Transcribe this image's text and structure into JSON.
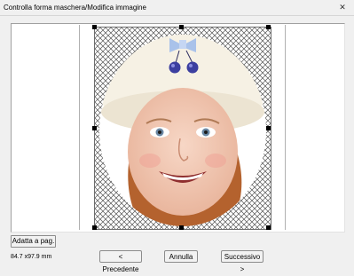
{
  "window": {
    "title": "Controlla forma maschera/Modifica immagine",
    "close_glyph": "✕"
  },
  "preview": {
    "subject": "photo-child-face",
    "mask_shape": "ellipse",
    "transparent_pattern": "checkerboard-crosshatch"
  },
  "controls": {
    "fit_label": "Adatta a pag.",
    "size_label": "84.7 x97.9 mm"
  },
  "nav": {
    "prev_label": "< Precedente",
    "cancel_label": "Annulla",
    "next_label": "Successivo >"
  },
  "colors": {
    "window_bg": "#f0f0f0",
    "panel_bg": "#ffffff",
    "handle": "#000000"
  }
}
